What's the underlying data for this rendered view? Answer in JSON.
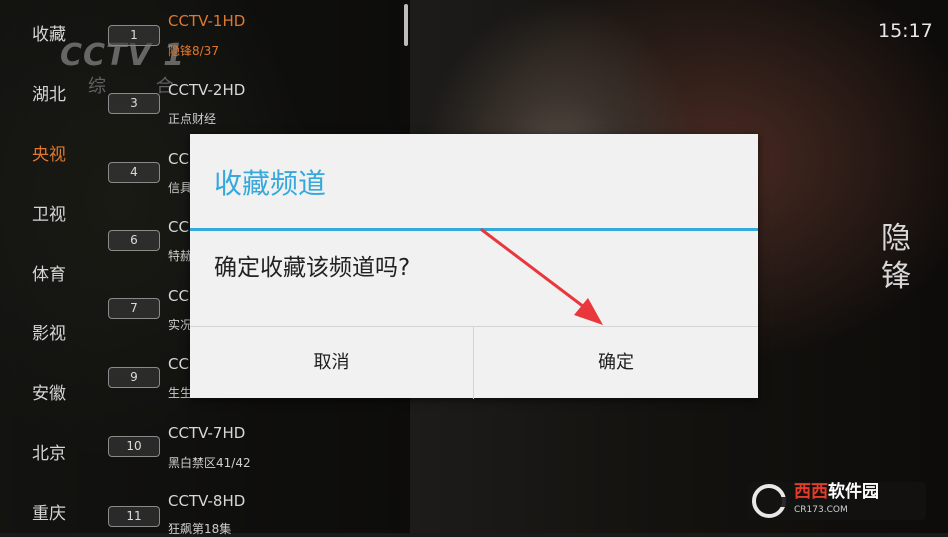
{
  "clock": "15:17",
  "channel_logo": {
    "mark": "CCTV 1",
    "sub": "综 合"
  },
  "video_title_watermark": "隐锋",
  "brand_watermark": {
    "main_a": "西西",
    "main_b": "软件园",
    "url": "CR173.COM"
  },
  "categories": [
    {
      "label": "收藏",
      "active": false
    },
    {
      "label": "湖北",
      "active": false
    },
    {
      "label": "央视",
      "active": true
    },
    {
      "label": "卫视",
      "active": false
    },
    {
      "label": "体育",
      "active": false
    },
    {
      "label": "影视",
      "active": false
    },
    {
      "label": "安徽",
      "active": false
    },
    {
      "label": "北京",
      "active": false
    },
    {
      "label": "重庆",
      "active": false
    }
  ],
  "channels": [
    {
      "number": "1",
      "name": "CCTV-1HD",
      "program": "隐锋8/37",
      "active": true
    },
    {
      "number": "3",
      "name": "CCTV-2HD",
      "program": "正点财经",
      "active": false
    },
    {
      "number": "4",
      "name": "CC",
      "program": "信具",
      "active": false
    },
    {
      "number": "6",
      "name": "CC",
      "program": "特赫",
      "active": false
    },
    {
      "number": "7",
      "name": "CC",
      "program": "实况",
      "active": false
    },
    {
      "number": "9",
      "name": "CC",
      "program": "生生",
      "active": false
    },
    {
      "number": "10",
      "name": "CCTV-7HD",
      "program": "黑白禁区41/42",
      "active": false
    },
    {
      "number": "11",
      "name": "CCTV-8HD",
      "program": "狂飙第18集",
      "active": false
    }
  ],
  "dialog": {
    "title": "收藏频道",
    "message": "确定收藏该频道吗?",
    "cancel_label": "取消",
    "ok_label": "确定"
  },
  "colors": {
    "accent": "#35a9dc",
    "active": "#e0782e",
    "arrow": "#e8383d"
  }
}
